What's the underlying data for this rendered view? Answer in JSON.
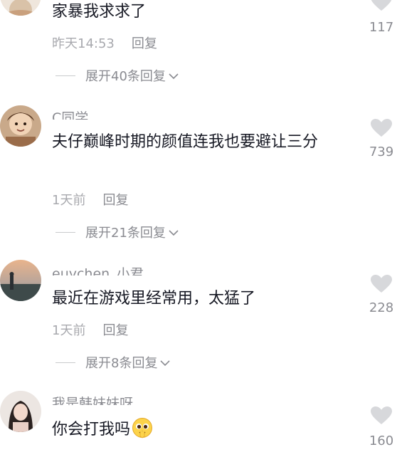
{
  "comments": [
    {
      "text": "家暴我求求了",
      "time": "昨天14:53",
      "reply_label": "回复",
      "expand_label": "展开40条回复",
      "likes": "117"
    },
    {
      "username": "C同学",
      "text": "夫仔巅峰时期的颜值连我也要避让三分",
      "time": "1天前",
      "reply_label": "回复",
      "expand_label": "展开21条回复",
      "likes": "739"
    },
    {
      "username": "euychen_小君",
      "text": "最近在游戏里经常用，太猛了",
      "time": "1天前",
      "reply_label": "回复",
      "expand_label": "展开8条回复",
      "likes": "228"
    },
    {
      "username": "我是韩妹妹呀",
      "text": "你会打我吗",
      "likes": "160"
    }
  ],
  "icons": {
    "like": "heart-icon",
    "expand": "chevron-down-icon",
    "emoji": "pleading-face-icon"
  },
  "colors": {
    "text": "#161823",
    "secondary": "#8a8b91",
    "heart": "#d7d8db"
  }
}
